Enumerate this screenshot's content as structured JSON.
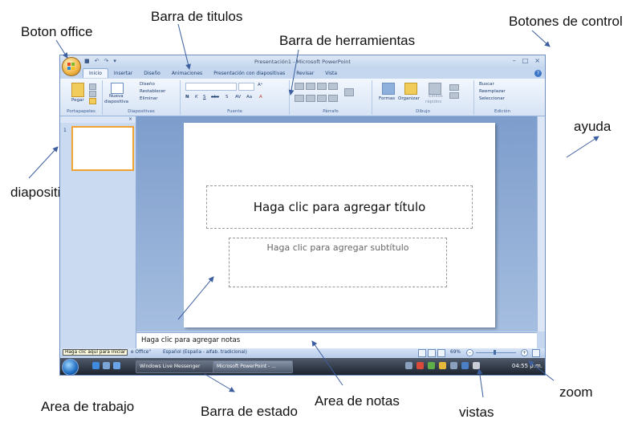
{
  "annotations": {
    "boton_office": "Boton office",
    "barra_titulos": "Barra  de titulos",
    "botones_control": "Botones de control",
    "barra_herramientas": "Barra de herramientas",
    "ayuda": "ayuda",
    "diapositiva": "diapositiva",
    "area_trabajo": "Area de trabajo",
    "barra_estado": "Barra de estado",
    "area_notas": "Area de notas",
    "vistas": "vistas",
    "zoom": "zoom"
  },
  "window": {
    "title": "Presentación1 - Microsoft PowerPoint",
    "tabs": [
      "Inicio",
      "Insertar",
      "Diseño",
      "Animaciones",
      "Presentación con diapositivas",
      "Revisar",
      "Vista"
    ],
    "active_tab": "Inicio"
  },
  "ribbon": {
    "clipboard": {
      "paste": "Pegar",
      "group": "Portapapeles"
    },
    "slides": {
      "new_slide_1": "Nueva",
      "new_slide_2": "diapositiva",
      "layout": "Diseño",
      "reset": "Restablecer",
      "delete": "Eliminar",
      "group": "Diapositivas"
    },
    "font": {
      "group": "Fuente"
    },
    "paragraph": {
      "group": "Párrafo"
    },
    "drawing": {
      "shapes": "Formas",
      "arrange": "Organizar",
      "quick_styles_1": "Estilos",
      "quick_styles_2": "rápidos",
      "group": "Dibujo"
    },
    "editing": {
      "find": "Buscar",
      "replace": "Reemplazar",
      "select": "Seleccionar",
      "group": "Edición"
    }
  },
  "slide_panel": {
    "slide_number": "1"
  },
  "slide": {
    "title_placeholder": "Haga clic para agregar título",
    "subtitle_placeholder": "Haga clic para agregar subtítulo"
  },
  "notes": {
    "placeholder": "Haga clic para agregar notas"
  },
  "status_bar": {
    "tooltip": "Haga clic aquí para iniciar",
    "theme": "e Office\"",
    "language": "Español (España - alfab. tradicional)",
    "zoom": "69%"
  },
  "taskbar": {
    "messenger": "Windows Live Messenger",
    "powerpoint": "Microsoft PowerPoint - ...",
    "time": "04:55 p.m."
  },
  "colors": {
    "accent": "#f0a233",
    "ribbon": "#d6e3f5",
    "taskbar": "#1d242f"
  }
}
